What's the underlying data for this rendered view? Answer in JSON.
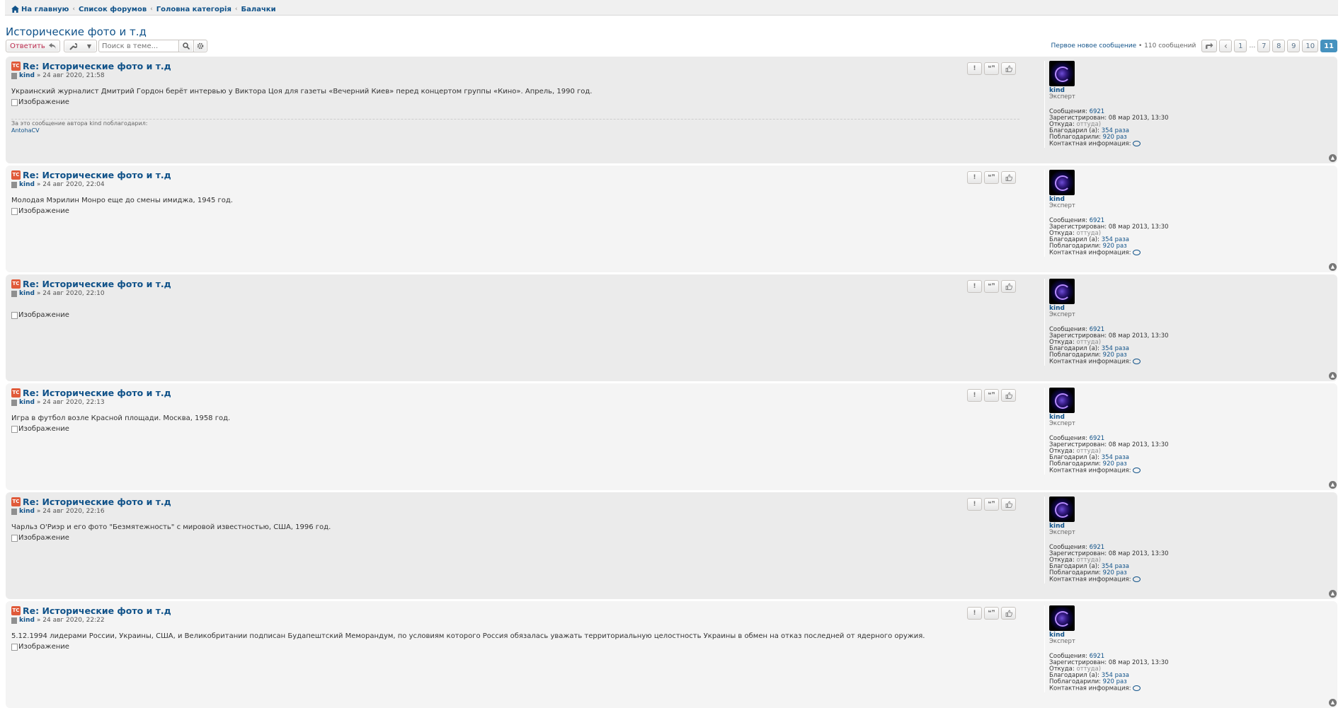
{
  "breadcrumb": [
    {
      "label": "На главную"
    },
    {
      "label": "Список форумов"
    },
    {
      "label": "Головна категорія"
    },
    {
      "label": "Балачки"
    }
  ],
  "topic": {
    "title": "Исторические фото и т.д"
  },
  "toolbar": {
    "reply_label": "Ответить",
    "search_placeholder": "Поиск в теме..."
  },
  "pagination": {
    "first_unread": "Первое новое сообщение",
    "count_text": "• 110 сообщений",
    "pages": [
      "1",
      "…",
      "7",
      "8",
      "9",
      "10",
      "11"
    ],
    "current": "11"
  },
  "profile": {
    "username": "kind",
    "rank": "Эксперт",
    "posts_label": "Сообщения:",
    "posts": "6921",
    "registered_label": "Зарегистрирован:",
    "registered": "08 мар 2013, 13:30",
    "from_label": "Откуда:",
    "from": "оттуда)",
    "thanked_label": "Благодарил (а):",
    "thanked": "354 раза",
    "was_thanked_label": "Поблагодарили:",
    "was_thanked": "920 раз",
    "contact_label": "Контактная информация:"
  },
  "image_alt": "Изображение",
  "posts": [
    {
      "title": "Re: Исторические фото и т.д",
      "author": "kind",
      "date": "» 24 авг 2020, 21:58",
      "text": "Украинский журналист Дмитрий Гордон берёт интервью у Виктора Цоя для газеты «Вечерний Киев» перед концертом группы «Кино». Апрель, 1990 год.",
      "thanks_label": "За это сообщение автора kind поблагодарил:",
      "thanks_user": "AntohaCV"
    },
    {
      "title": "Re: Исторические фото и т.д",
      "author": "kind",
      "date": "» 24 авг 2020, 22:04",
      "text": "Молодая Мэрилин Монро еще до смены имиджа, 1945 год."
    },
    {
      "title": "Re: Исторические фото и т.д",
      "author": "kind",
      "date": "» 24 авг 2020, 22:10",
      "text": ""
    },
    {
      "title": "Re: Исторические фото и т.д",
      "author": "kind",
      "date": "» 24 авг 2020, 22:13",
      "text": "Игра в футбол возле Красной площади. Москва, 1958 год."
    },
    {
      "title": "Re: Исторические фото и т.д",
      "author": "kind",
      "date": "» 24 авг 2020, 22:16",
      "text": "Чарльз О'Риэр и его фото \"Безмятежность\" с мировой известностью, США, 1996 год."
    },
    {
      "title": "Re: Исторические фото и т.д",
      "author": "kind",
      "date": "» 24 авг 2020, 22:22",
      "text": "5.12.1994 лидерами России, Украины, США, и Великобритании подписан Будапештский Меморандум, по условиям которого Россия обязалась уважать территориальную целостность Украины в обмен на отказ последней от ядерного оружия."
    }
  ],
  "colors": {
    "link": "#105289",
    "reply": "#bc2a4d",
    "current_page": "#4692bf",
    "post_bg_a": "#ebebeb",
    "post_bg_b": "#f4f4f4"
  }
}
